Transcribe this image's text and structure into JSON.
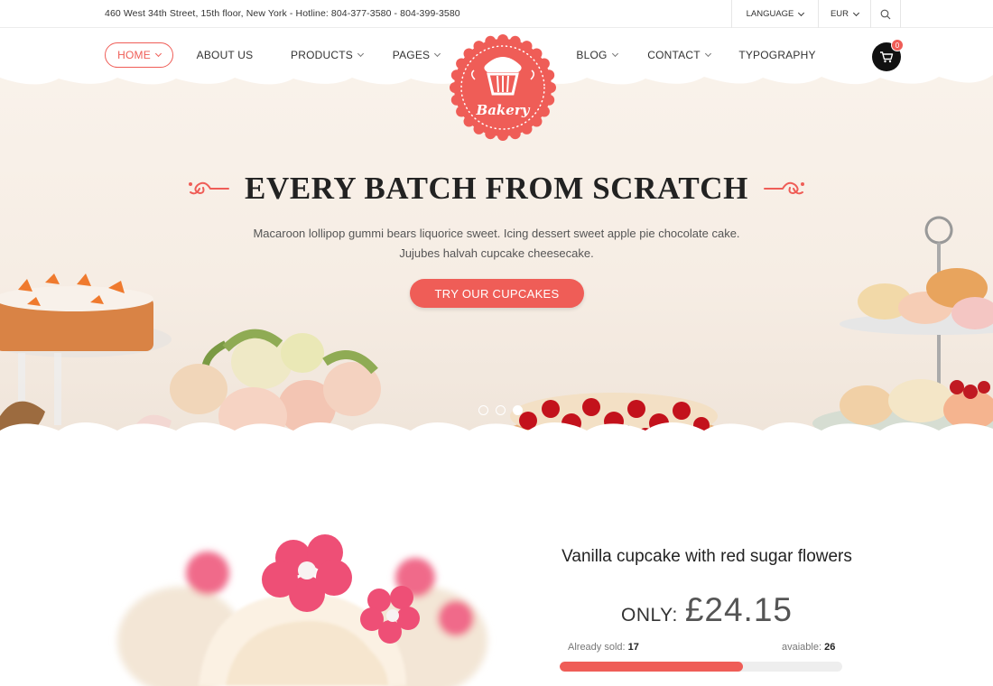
{
  "topbar": {
    "info": "460 West 34th Street, 15th floor, New York - Hotline: 804-377-3580 - 804-399-3580",
    "language": "LANGUAGE",
    "currency": "EUR"
  },
  "nav": {
    "items": [
      {
        "label": "HOME"
      },
      {
        "label": "ABOUT US"
      },
      {
        "label": "PRODUCTS"
      },
      {
        "label": "PAGES"
      },
      {
        "label": "BLOG"
      },
      {
        "label": "CONTACT"
      },
      {
        "label": "TYPOGRAPHY"
      }
    ],
    "cart_count": "0"
  },
  "logo": {
    "text": "Bakery"
  },
  "hero": {
    "headline": "EVERY BATCH FROM SCRATCH",
    "subtext_line1": "Macaroon lollipop gummi bears liquorice sweet. Icing dessert sweet apple pie chocolate cake.",
    "subtext_line2": "Jujubes halvah cupcake cheesecake.",
    "cta": "TRY OUR CUPCAKES",
    "slide_count": 3,
    "active_slide": 3
  },
  "product": {
    "title": "Vanilla cupcake with red sugar flowers",
    "only_label": "ONLY:",
    "price": "£24.15",
    "sold_label": "Already sold:",
    "sold": "17",
    "avail_label": "avaiable:",
    "avail": "26",
    "sold_fraction": 0.65
  },
  "colors": {
    "accent": "#ef5d57",
    "text": "#222222"
  }
}
